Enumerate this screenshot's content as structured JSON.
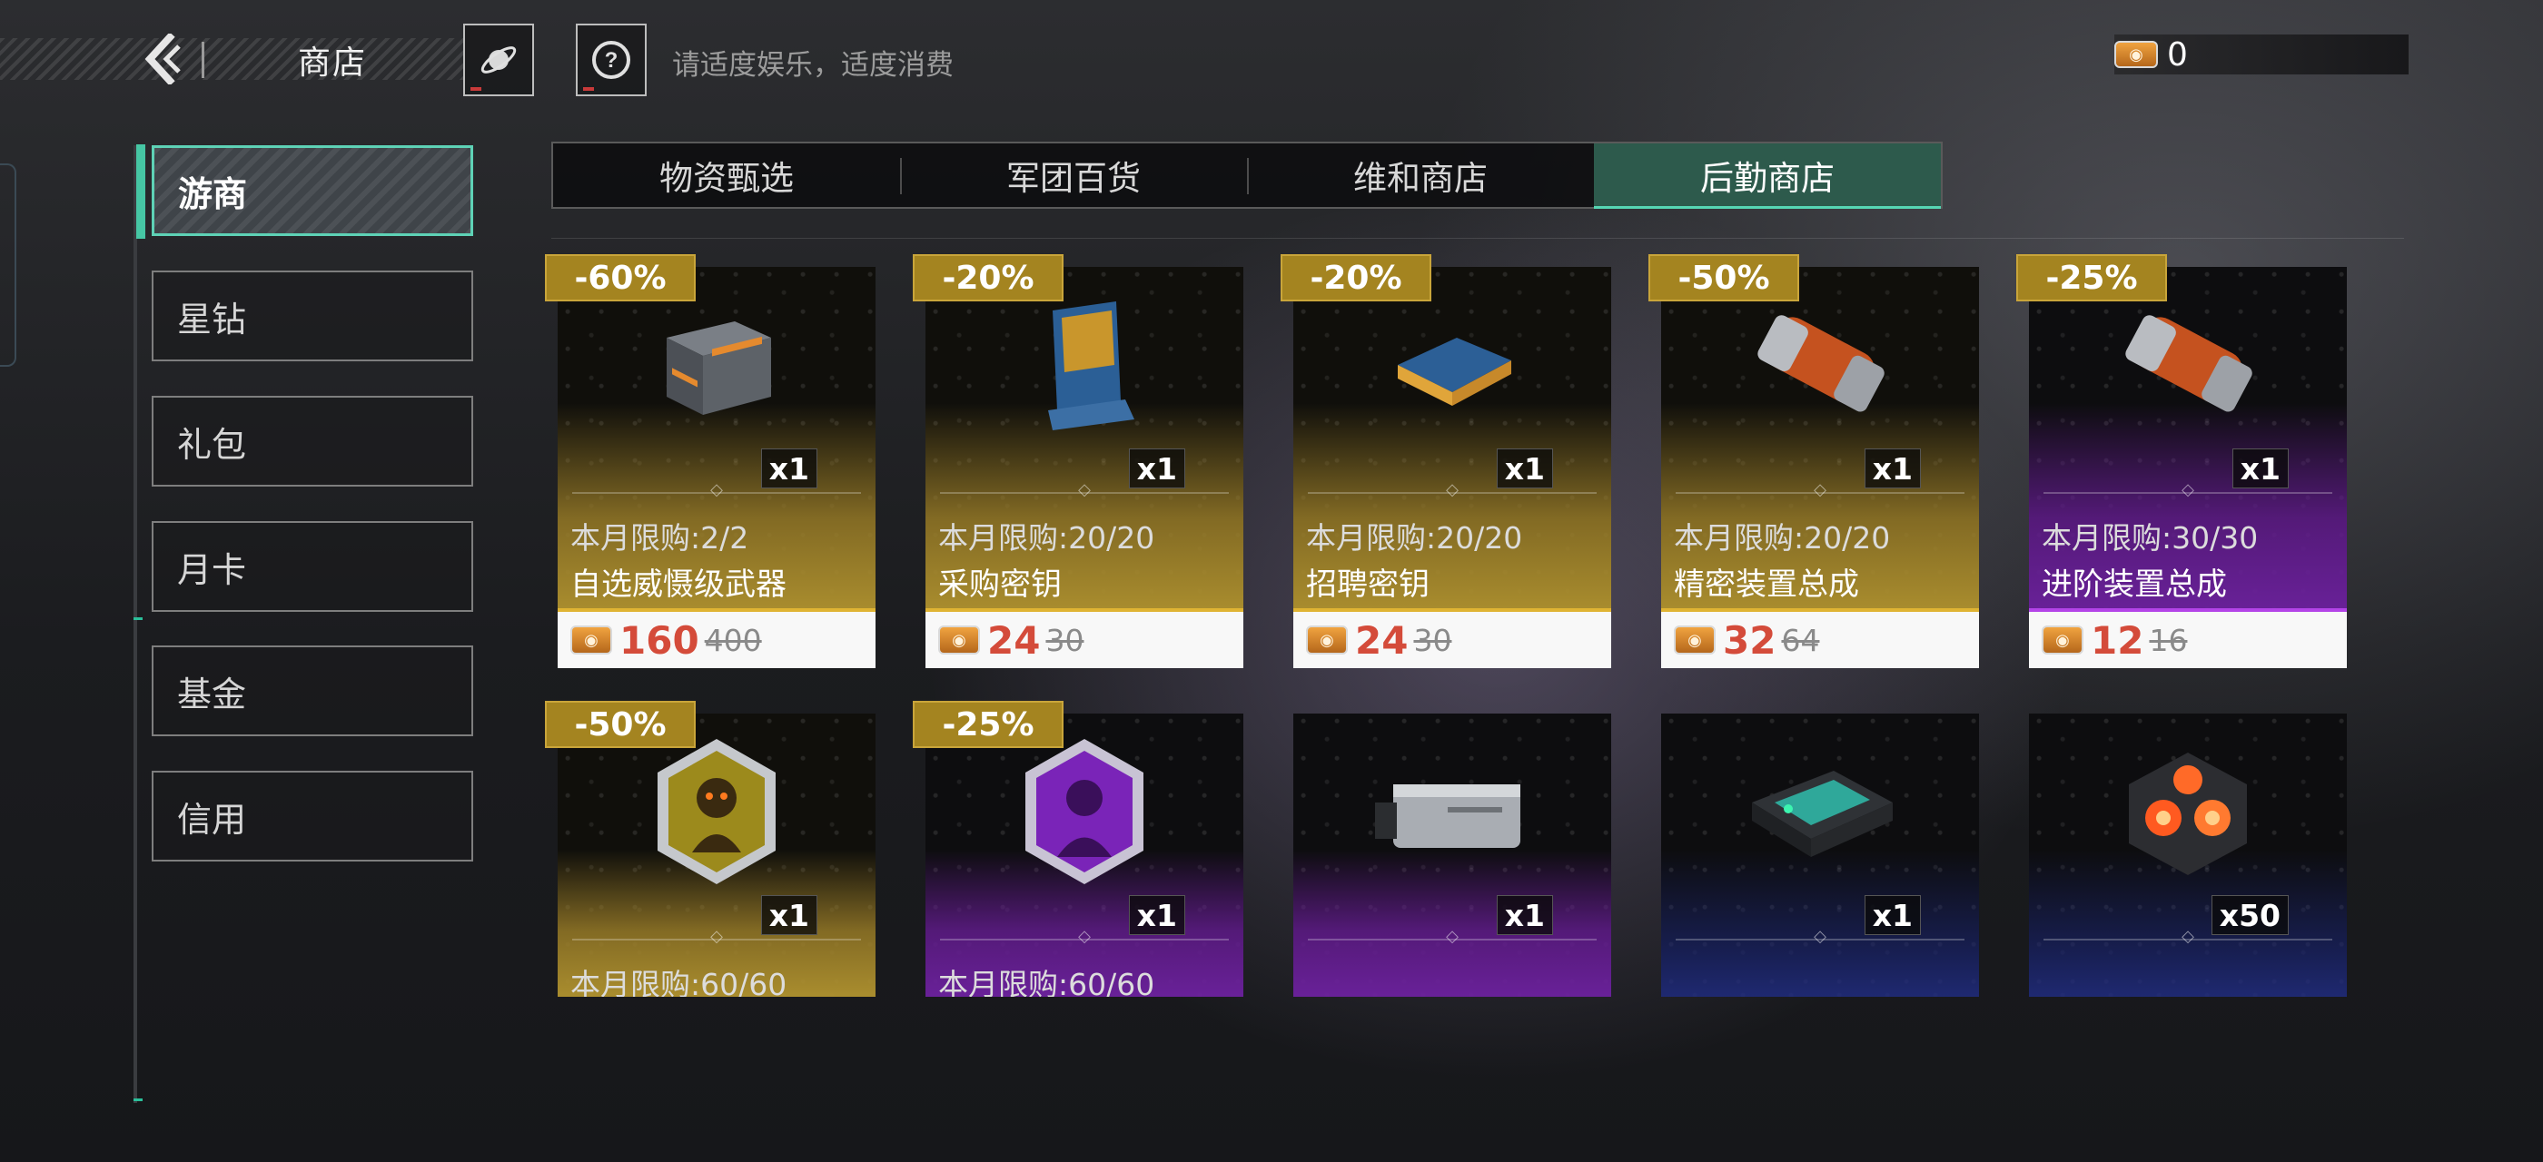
{
  "header": {
    "title": "商店",
    "tagline": "请适度娱乐，适度消费",
    "currency_value": "0"
  },
  "nav": [
    {
      "label": "游商",
      "active": true
    },
    {
      "label": "星钻",
      "active": false
    },
    {
      "label": "礼包",
      "active": false
    },
    {
      "label": "月卡",
      "active": false
    },
    {
      "label": "基金",
      "active": false
    },
    {
      "label": "信用",
      "active": false
    }
  ],
  "tabs": [
    {
      "label": "物资甄选",
      "active": false
    },
    {
      "label": "军团百货",
      "active": false
    },
    {
      "label": "维和商店",
      "active": false
    },
    {
      "label": "后勤商店",
      "active": true
    }
  ],
  "items_row1": [
    {
      "discount": "-60%",
      "qty": "x1",
      "limit": "本月限购:2/2",
      "name": "自选威慑级武器",
      "price": "160",
      "old_price": "400",
      "rarity": "gold",
      "icon": "crate-icon"
    },
    {
      "discount": "-20%",
      "qty": "x1",
      "limit": "本月限购:20/20",
      "name": "采购密钥",
      "price": "24",
      "old_price": "30",
      "rarity": "gold",
      "icon": "keycard-icon"
    },
    {
      "discount": "-20%",
      "qty": "x1",
      "limit": "本月限购:20/20",
      "name": "招聘密钥",
      "price": "24",
      "old_price": "30",
      "rarity": "gold",
      "icon": "chip-icon"
    },
    {
      "discount": "-50%",
      "qty": "x1",
      "limit": "本月限购:20/20",
      "name": "精密装置总成",
      "price": "32",
      "old_price": "64",
      "rarity": "gold",
      "icon": "canister-icon"
    },
    {
      "discount": "-25%",
      "qty": "x1",
      "limit": "本月限购:30/30",
      "name": "进阶装置总成",
      "price": "12",
      "old_price": "16",
      "rarity": "purple",
      "icon": "canister-icon"
    }
  ],
  "items_row2": [
    {
      "discount": "-50%",
      "qty": "x1",
      "limit": "本月限购:60/60",
      "rarity": "gold",
      "icon": "hex-badge-gold-icon"
    },
    {
      "discount": "-25%",
      "qty": "x1",
      "limit": "本月限购:60/60",
      "rarity": "purple",
      "icon": "hex-badge-purple-icon"
    },
    {
      "discount": "",
      "qty": "x1",
      "limit": "",
      "rarity": "purple",
      "icon": "battery-icon"
    },
    {
      "discount": "",
      "qty": "x1",
      "limit": "",
      "rarity": "blue",
      "icon": "power-cell-icon"
    },
    {
      "discount": "",
      "qty": "x50",
      "limit": "",
      "rarity": "blue",
      "icon": "core-cube-icon"
    }
  ],
  "colors": {
    "accent": "#56d6b4",
    "gold": "#a48420",
    "price": "#d44b3a"
  }
}
